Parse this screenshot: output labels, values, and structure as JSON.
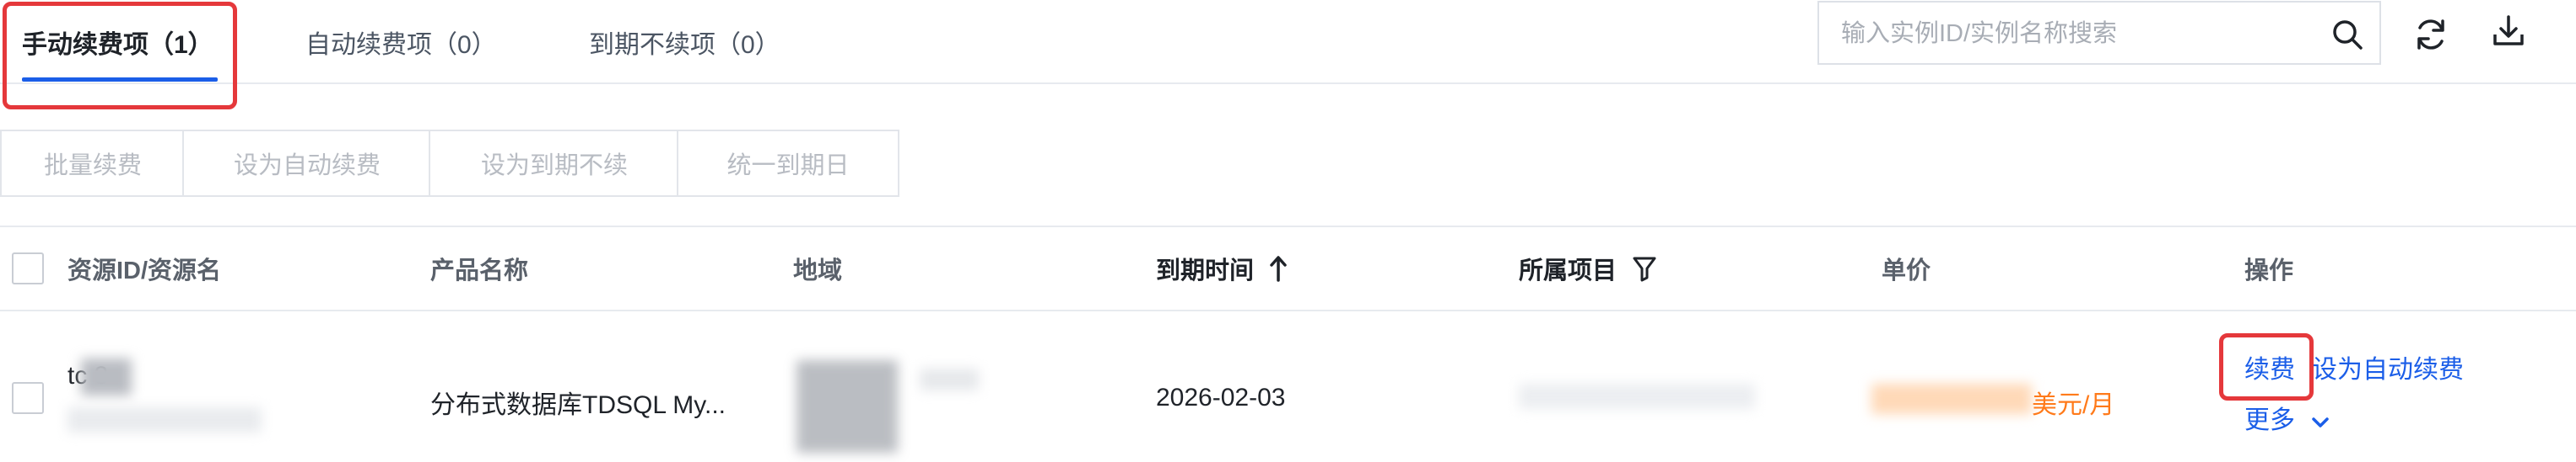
{
  "tabs": [
    {
      "label": "手动续费项（1）",
      "active": true
    },
    {
      "label": "自动续费项（0）",
      "active": false
    },
    {
      "label": "到期不续项（0）",
      "active": false
    }
  ],
  "search": {
    "placeholder": "输入实例ID/实例名称搜索",
    "value": ""
  },
  "toolbar_icons": {
    "search": "search-icon",
    "refresh": "refresh-icon",
    "download": "download-icon"
  },
  "actions": {
    "batch_renew": "批量续费",
    "set_auto_renew": "设为自动续费",
    "set_no_renew": "设为到期不续",
    "unify_expiry": "统一到期日"
  },
  "table": {
    "headers": {
      "resource": "资源ID/资源名",
      "product": "产品名称",
      "region": "地域",
      "expiry": "到期时间",
      "project": "所属项目",
      "price": "单价",
      "ops": "操作"
    },
    "rows": [
      {
        "resource_id": "tc      3",
        "product": "分布式数据库TDSQL My...",
        "expiry": "2026-02-03",
        "price_unit": "美元/月",
        "renew": "续费",
        "set_auto": "设为自动续费",
        "more": "更多"
      }
    ]
  },
  "colors": {
    "accent": "#1b5ee8",
    "highlight": "#e5383b",
    "price": "#ff7a1a"
  }
}
